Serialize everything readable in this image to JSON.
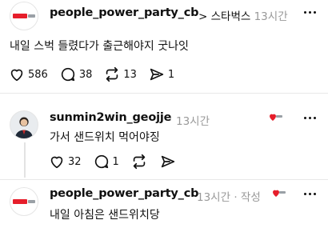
{
  "post1": {
    "username": "people_power_party_cb",
    "chevron": ">",
    "topic": "스타벅스",
    "time": "13시간",
    "text": "내일 스벅 들렸다가 출근해야지 굿나잇",
    "likes": "586",
    "comments": "38",
    "reposts": "13",
    "shares": "1"
  },
  "reply1": {
    "username": "sunmin2win_geojje",
    "time": "13시간",
    "text": "가서 샌드위치 먹어야징",
    "likes": "32",
    "comments": "1"
  },
  "reply2": {
    "username": "people_power_party_cb",
    "time": "13시간",
    "separator": "·",
    "author_tag": "작성",
    "text": "내일 아침은 샌드위치당"
  },
  "colors": {
    "brand_red": "#e61e2b",
    "muted_text": "#999999"
  },
  "icons": [
    "heart-icon",
    "comment-icon",
    "repost-icon",
    "share-icon",
    "more-icon"
  ]
}
